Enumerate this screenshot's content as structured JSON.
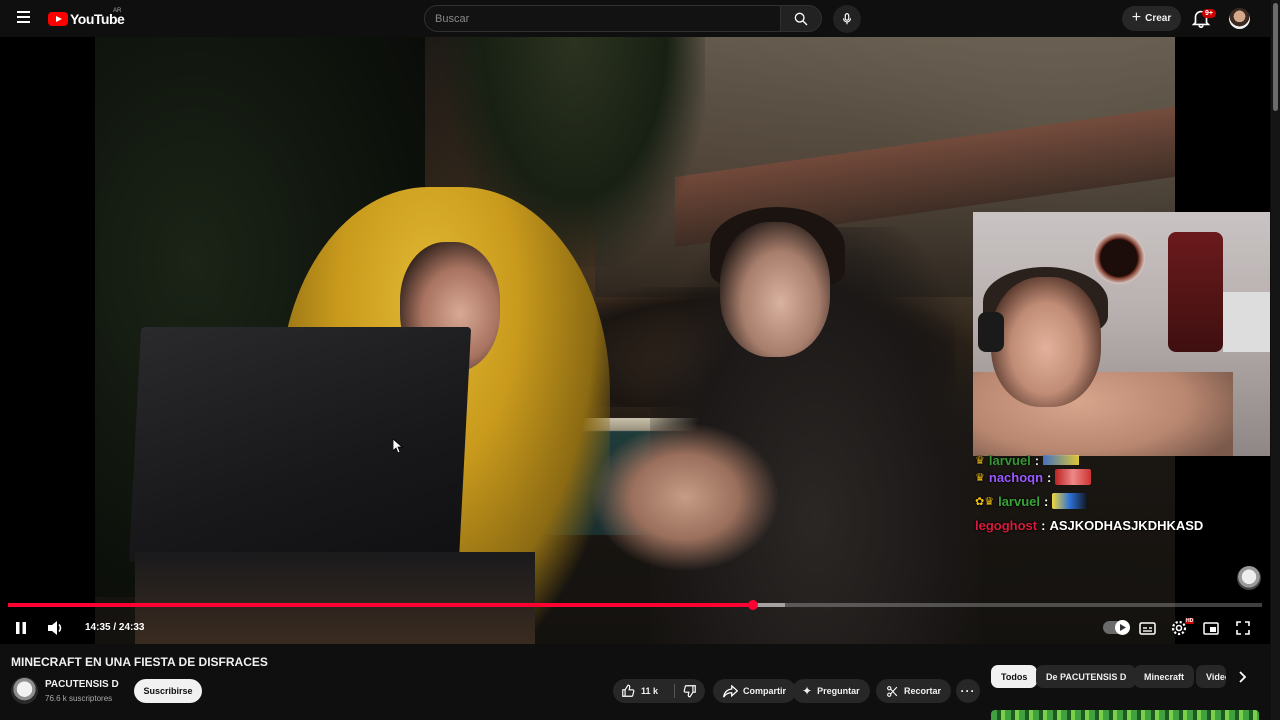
{
  "header": {
    "logo_text": "YouTube",
    "country_code": "AR",
    "search_placeholder": "Buscar",
    "create_label": "Crear",
    "notifications_badge": "9+",
    "icons": [
      "menu-icon",
      "search-icon",
      "microphone-icon",
      "plus-icon",
      "bell-icon"
    ]
  },
  "chat": {
    "messages": [
      {
        "user": "larvuel",
        "text": "",
        "user_color": "#3aa63a",
        "emote": true
      },
      {
        "user": "nachoqn",
        "text": "",
        "user_color": "#9b59ff",
        "emote": true
      },
      {
        "user": "larvuel",
        "text": "",
        "user_color": "#3aa63a",
        "emote": true
      },
      {
        "user": "legoghost",
        "text": "ASJKODHASJKDHKASD",
        "user_color": "#d81b3c",
        "emote": false
      }
    ]
  },
  "player": {
    "current_time": "14:35",
    "duration": "24:33",
    "time_display": "14:35 / 24:33",
    "progress_played": 0.594,
    "progress_buffered": 0.62,
    "accent_color": "#ff0033",
    "settings_badge": "HD",
    "icons": [
      "pause-icon",
      "volume-icon",
      "autoplay-toggle",
      "subtitles-icon",
      "settings-icon",
      "miniplayer-icon",
      "fullscreen-icon"
    ]
  },
  "video": {
    "title": "MINECRAFT EN UNA FIESTA DE DISFRACES",
    "channel_name": "PACUTENSIS D",
    "subscribers": "76.6 k suscriptores",
    "subscribe_label": "Suscribirse",
    "likes": "11 k",
    "share_label": "Compartir",
    "ask_label": "Preguntar",
    "clip_label": "Recortar"
  },
  "chips": [
    "Todos",
    "De PACUTENSIS D",
    "Minecraft",
    "Videos"
  ]
}
